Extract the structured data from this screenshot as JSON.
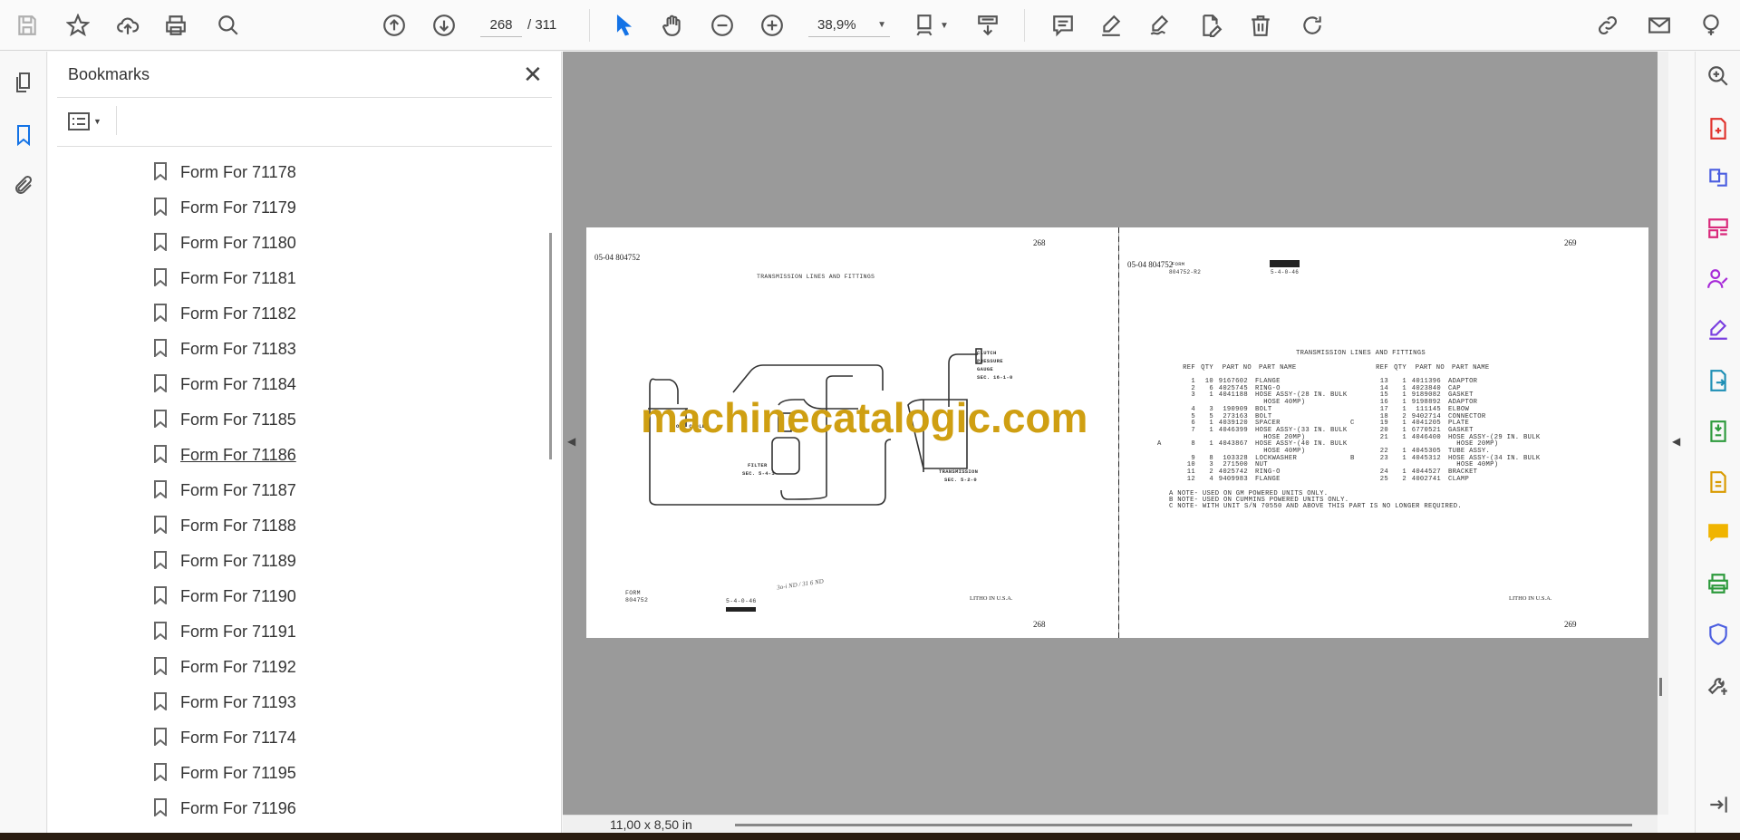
{
  "toolbar": {
    "page_current": "268",
    "page_total": "/ 311",
    "zoom": "38,9%"
  },
  "bookmarks": {
    "title": "Bookmarks",
    "items": [
      "Form For 71178",
      "Form For 71179",
      "Form For 71180",
      "Form For 71181",
      "Form For 71182",
      "Form For 71183",
      "Form For 71184",
      "Form For 71185",
      "Form For 71186",
      "Form For 71187",
      "Form For 71188",
      "Form For 71189",
      "Form For 71190",
      "Form For 71191",
      "Form For 71192",
      "Form For 71193",
      "Form For 71174",
      "Form For 71195",
      "Form For 71196"
    ]
  },
  "left_page": {
    "header": "05-04  804752",
    "page_no": "268",
    "title": "TRANSMISSION LINES AND FITTINGS",
    "callouts": {
      "clutch": "CLUTCH",
      "pressure": "PRESSURE",
      "gauge": "GAUGE",
      "gauge_sec": "SEC. 16-1-0",
      "filter": "FILTER",
      "filter_sec": "SEC. 5-4-1",
      "transmission": "TRANSMISSION",
      "trans_sec": "SEC. 5-2-0",
      "oil_cooler": "OIL COOLER"
    },
    "form_label": "FORM",
    "form_no": "804752",
    "code": "5-4-0-46",
    "litho": "LITHO IN U.S.A.",
    "handwriting": "3o-i ND / 31 6 ND",
    "watermark": "machinecatalogic.com"
  },
  "right_page": {
    "header": "05-04  804752",
    "form_label": "FORM",
    "form_no": "804752-R2",
    "code": "5-4-0-46",
    "page_no": "269",
    "title": "TRANSMISSION LINES AND FITTINGS",
    "litho": "LITHO IN U.S.A.",
    "columns": {
      "ref": "REF",
      "qty": "QTY",
      "part_no": "PART NO",
      "part_name": "PART NAME"
    },
    "left_rows": [
      [
        "",
        "1",
        "10",
        "9167602",
        "FLANGE"
      ],
      [
        "",
        "2",
        "6",
        "4025745",
        "RING-O"
      ],
      [
        "",
        "3",
        "1",
        "4041188",
        "HOSE ASSY-(28 IN. BULK"
      ],
      [
        "",
        "",
        "",
        "",
        "  HOSE 40MP)"
      ],
      [
        "",
        "4",
        "3",
        "190909",
        "BOLT"
      ],
      [
        "",
        "5",
        "5",
        "273163",
        "BOLT"
      ],
      [
        "",
        "6",
        "1",
        "4039120",
        "SPACER"
      ],
      [
        "",
        "7",
        "1",
        "4046399",
        "HOSE ASSY-(33 IN. BULK"
      ],
      [
        "",
        "",
        "",
        "",
        "  HOSE 20MP)"
      ],
      [
        "A",
        "8",
        "1",
        "4043867",
        "HOSE ASSY-(40 IN. BULK"
      ],
      [
        "",
        "",
        "",
        "",
        "  HOSE 40MP)"
      ],
      [
        "",
        "9",
        "8",
        "103328",
        "LOCKWASHER"
      ],
      [
        "",
        "10",
        "3",
        "271500",
        "NUT"
      ],
      [
        "",
        "11",
        "2",
        "4025742",
        "RING-O"
      ],
      [
        "",
        "12",
        "4",
        "9409983",
        "FLANGE"
      ]
    ],
    "right_rows": [
      [
        "",
        "13",
        "1",
        "4011396",
        "ADAPTOR"
      ],
      [
        "",
        "14",
        "1",
        "4023840",
        "CAP"
      ],
      [
        "",
        "15",
        "1",
        "9189082",
        "GASKET"
      ],
      [
        "",
        "16",
        "1",
        "9198892",
        "ADAPTOR"
      ],
      [
        "",
        "17",
        "1",
        "111145",
        "ELBOW"
      ],
      [
        "",
        "18",
        "2",
        "9402714",
        "CONNECTOR"
      ],
      [
        "C",
        "19",
        "1",
        "4041205",
        "PLATE"
      ],
      [
        "",
        "20",
        "1",
        "6770521",
        "GASKET"
      ],
      [
        "",
        "21",
        "1",
        "4046400",
        "HOSE ASSY-(29 IN. BULK"
      ],
      [
        "",
        "",
        "",
        "",
        "  HOSE 20MP)"
      ],
      [
        "",
        "22",
        "1",
        "4045305",
        "TUBE ASSY."
      ],
      [
        "B",
        "23",
        "1",
        "4045312",
        "HOSE ASSY-(34 IN. BULK"
      ],
      [
        "",
        "",
        "",
        "",
        "  HOSE 40MP)"
      ],
      [
        "",
        "24",
        "1",
        "4044527",
        "BRACKET"
      ],
      [
        "",
        "25",
        "2",
        "4002741",
        "CLAMP"
      ]
    ],
    "notes": [
      "A  NOTE- USED ON GM POWERED UNITS ONLY.",
      "B  NOTE- USED ON CUMMINS POWERED UNITS ONLY.",
      "C  NOTE- WITH UNIT S/N 70550 AND ABOVE THIS PART IS NO LONGER REQUIRED."
    ]
  },
  "status": {
    "page_size": "11,00 x 8,50 in"
  },
  "colors": {
    "accent": "#1473e6",
    "watermark": "#cf9f12",
    "doc_bg": "#9a9a9a"
  }
}
